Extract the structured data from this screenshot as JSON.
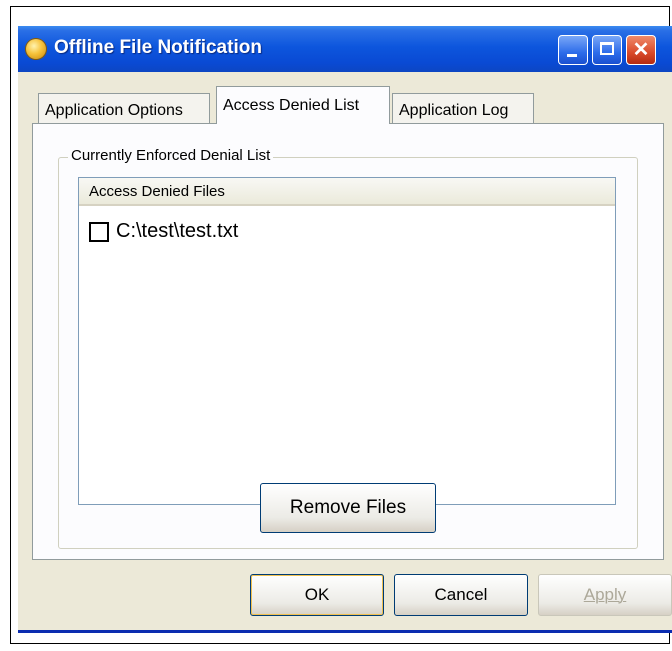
{
  "window": {
    "title": "Offline File  Notification",
    "icon": "app-orb-icon",
    "controls": {
      "minimize": "minimize-icon",
      "maximize": "maximize-icon",
      "close": "close-icon",
      "close_glyph": "✕"
    }
  },
  "tabs": [
    {
      "label": "Application Options",
      "selected": false
    },
    {
      "label": "Access Denied List",
      "selected": true
    },
    {
      "label": "Application Log",
      "selected": false
    }
  ],
  "group": {
    "label": "Currently Enforced Denial List",
    "list": {
      "column_header": "Access Denied Files",
      "items": [
        {
          "path": "C:\\test\\test.txt",
          "checked": false
        }
      ]
    },
    "remove_button": "Remove Files"
  },
  "buttons": {
    "ok": "OK",
    "cancel": "Cancel",
    "apply": "Apply"
  },
  "colors": {
    "titlebar": "#0a4ad4",
    "dialog_bg": "#ece9d8",
    "panel_bg": "#fcfcfe"
  }
}
